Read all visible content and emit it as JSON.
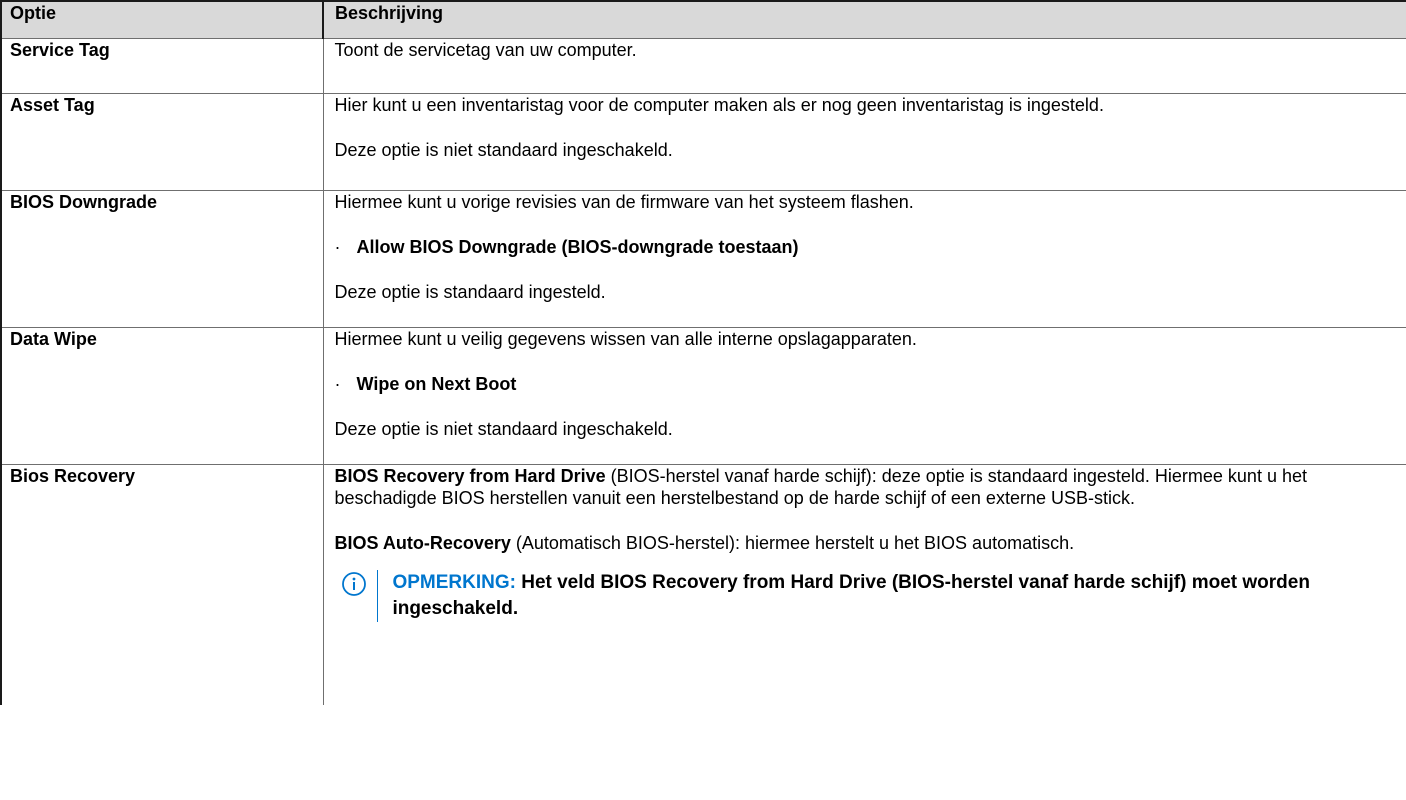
{
  "table": {
    "header": {
      "option": "Optie",
      "description": "Beschrijving"
    },
    "rows": {
      "service_tag": {
        "option": "Service Tag",
        "p1": "Toont de servicetag van uw computer."
      },
      "asset_tag": {
        "option": "Asset Tag",
        "p1": "Hier kunt u een inventaristag voor de computer maken als er nog geen inventaristag is ingesteld.",
        "p2": "Deze optie is niet standaard ingeschakeld."
      },
      "bios_downgrade": {
        "option": "BIOS Downgrade",
        "p1": "Hiermee kunt u vorige revisies van de firmware van het systeem flashen.",
        "bullet_mark": "·",
        "bullet": "Allow BIOS Downgrade (BIOS-downgrade toestaan)",
        "p2": "Deze optie is standaard ingesteld."
      },
      "data_wipe": {
        "option": "Data Wipe",
        "p1": "Hiermee kunt u veilig gegevens wissen van alle interne opslagapparaten.",
        "bullet_mark": "·",
        "bullet": "Wipe on Next Boot",
        "p2": "Deze optie is niet standaard ingeschakeld."
      },
      "bios_recovery": {
        "option": "Bios Recovery",
        "p1_strong": "BIOS Recovery from Hard Drive",
        "p1_rest": " (BIOS-herstel vanaf harde schijf): deze optie is standaard ingesteld. Hiermee kunt u het beschadigde BIOS herstellen vanuit een herstelbestand op de harde schijf of een externe USB-stick.",
        "p2_strong": "BIOS Auto-Recovery",
        "p2_rest": " (Automatisch BIOS-herstel): hiermee herstelt u het BIOS automatisch.",
        "note_label": "OPMERKING:",
        "note_text": " Het veld BIOS Recovery from Hard Drive (BIOS-herstel vanaf harde schijf) moet worden ingeschakeld."
      }
    }
  },
  "colors": {
    "note_accent": "#0076ce",
    "header_bg": "#d9d9d9"
  },
  "icons": {
    "note": "info-icon"
  }
}
